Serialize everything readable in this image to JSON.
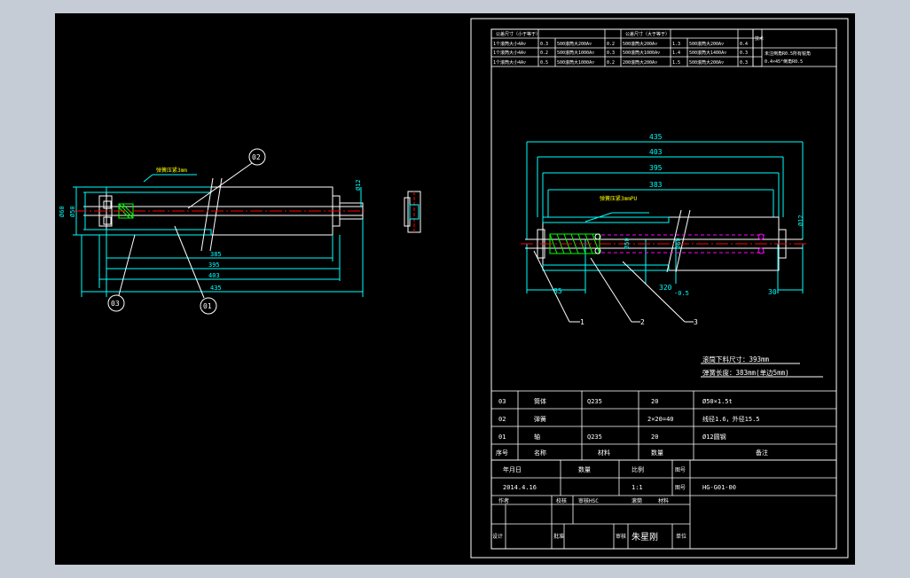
{
  "colors": {
    "workspace": "#c6ccd6",
    "canvas": "#000000",
    "line": "#ffffff",
    "dimension": "#00ffff",
    "centerline": "#ff0000",
    "spring": "#00ff00",
    "note": "#ffff00"
  },
  "left_view": {
    "balloons": [
      "02",
      "03",
      "01"
    ],
    "spring_note": "弹簧压紧3mm",
    "diameters": [
      "Ø60",
      "Ø50",
      "Ø12"
    ],
    "horizontal_dims": [
      "385",
      "395",
      "403",
      "435"
    ]
  },
  "right_view": {
    "top_dims": [
      "435",
      "403",
      "395",
      "383"
    ],
    "spring_note": "弹簧压紧3mmPU",
    "dia_left": "Ø50",
    "dia_mid": "Ø60",
    "dia_right": "Ø12",
    "dim_85": "85",
    "dim_320": "320",
    "dim_tol": "-0.5",
    "dim_30": "30",
    "leaders": [
      "1",
      "2",
      "3"
    ],
    "note_line1": "滚筒下料尺寸：393mm",
    "note_line2": "弹簧长度：383mm(单边5mm)"
  },
  "header_table": {
    "col_a_title": "公差尺寸（小于等于）",
    "col_b_title": "公差尺寸（大于等于）",
    "rows": [
      [
        "1个滚筒大小4A▽",
        "0.3",
        "500滚筒大200A▽",
        "0.2",
        "500滚筒大200A▽",
        "1.3",
        "500滚筒大200A▽",
        "0.4"
      ],
      [
        "1个滚筒大小4A▽",
        "0.2",
        "500滚筒大1000A▽",
        "0.3",
        "500滚筒大1000A▽",
        "1.4",
        "500滚筒大1400A▽",
        "0.3"
      ],
      [
        "1个滚筒大小4A▽",
        "0.5",
        "500滚筒大1000A▽",
        "0.2",
        "200滚筒大200A▽",
        "1.5",
        "500滚筒大200A▽",
        "0.3"
      ]
    ],
    "side_label": "技术",
    "side_note_1": "未注倒角R0.5所有锐角",
    "side_note_2": "0.4×45°倒角R0.5"
  },
  "parts_list": {
    "rows": [
      {
        "no": "03",
        "name": "筒体",
        "material": "Q235",
        "qty": "20",
        "note": "Ø50×1.5t"
      },
      {
        "no": "02",
        "name": "弹簧",
        "material": "",
        "qty": "2×20=40",
        "note": "线径1.6，外径15.5"
      },
      {
        "no": "01",
        "name": "轴",
        "material": "Q235",
        "qty": "20",
        "note": "Ø12圆钢"
      }
    ],
    "header": {
      "no": "序号",
      "name": "名称",
      "material": "材料",
      "qty": "数量",
      "note": "备注"
    }
  },
  "title_block": {
    "h_date": "年月日",
    "h_qty": "数量",
    "h_scale": "比例",
    "h_code": "图号",
    "date": "2014.4.16",
    "scale": "1:1",
    "code_label": "图号",
    "code": "HG-G01-00",
    "r_author": "作者",
    "r_check": "校核",
    "r_audit": "审核HSC",
    "r_title": "滚筒",
    "r_mat": "材料",
    "design_label": "设计",
    "approve_label": "批准",
    "sig_label": "审核",
    "signer": "朱星刚",
    "unit_label": "单位"
  }
}
